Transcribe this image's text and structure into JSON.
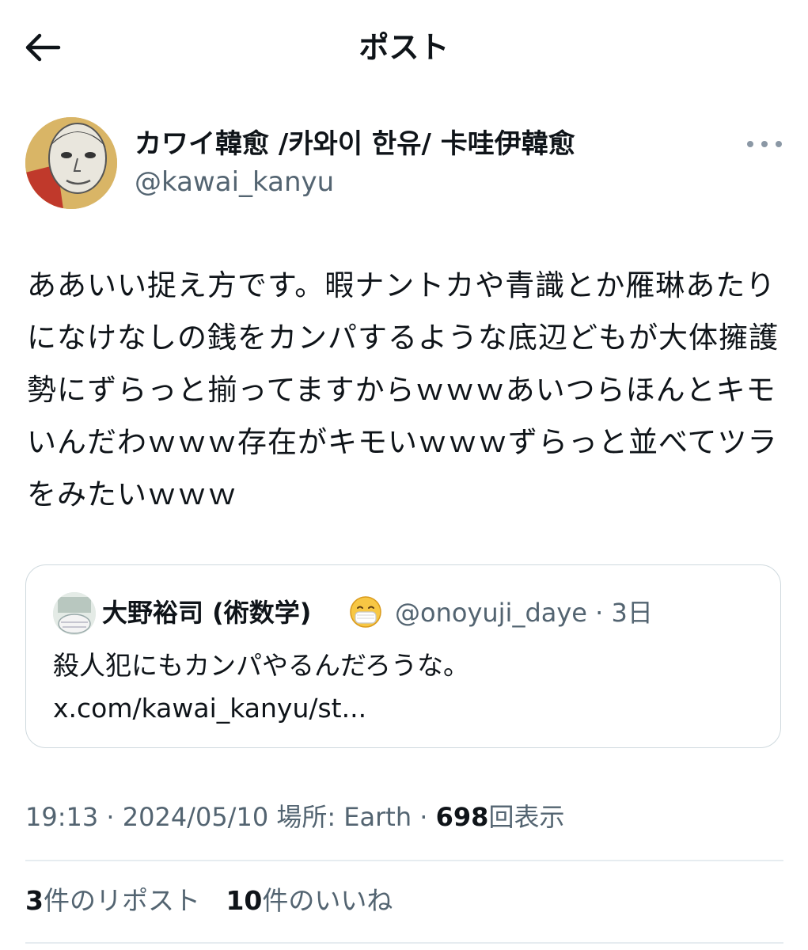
{
  "header": {
    "title": "ポスト",
    "back_icon": "arrow-left-icon"
  },
  "author": {
    "display_name": "カワイ韓愈 /카와이 한유/ 卡哇伊韓愈",
    "handle": "@kawai_kanyu",
    "more_icon": "more-horizontal-icon"
  },
  "post": {
    "text": "ああいい捉え方です。暇ナントカや青識とか雁琳あたりになけなしの銭をカンパするような底辺どもが大体擁護勢にずらっと揃ってますからｗｗｗあいつらほんとキモいんだわｗｗｗ存在がキモいｗｗｗずらっと並べてツラをみたいｗｗｗ"
  },
  "quote": {
    "name": "大野裕司 (術数学)",
    "emoji": "face-with-medical-mask",
    "handle": "@onoyuji_daye",
    "time": "· 3日",
    "text": "殺人犯にもカンパやるんだろうな。",
    "link": "x.com/kawai_kanyu/st..."
  },
  "meta": {
    "time": "19:13",
    "sep1": "·",
    "date": "2024/05/10",
    "location": "場所: Earth",
    "sep2": "·",
    "views": "698",
    "views_label": "回表示"
  },
  "stats": {
    "reposts": "3",
    "reposts_label": "件のリポスト",
    "likes": "10",
    "likes_label": "件のいいね"
  },
  "colors": {
    "text": "#0f1419",
    "secondary": "#536471",
    "border": "#cfd9de"
  }
}
